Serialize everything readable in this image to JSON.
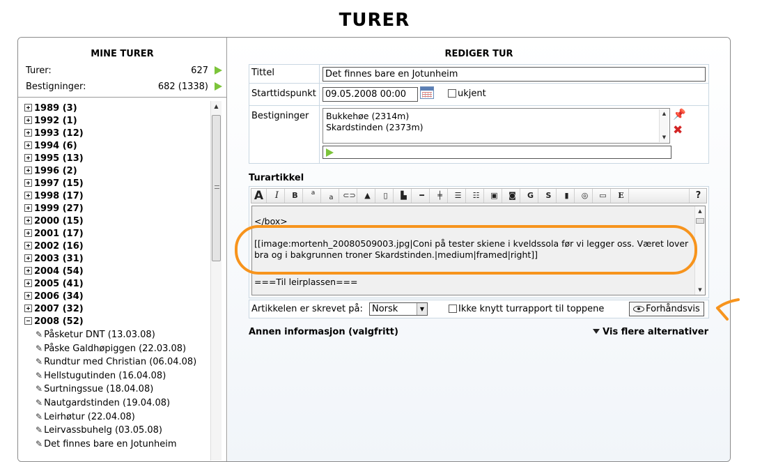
{
  "page": {
    "title": "TURER"
  },
  "left": {
    "title": "MINE TURER",
    "stats": [
      {
        "label": "Turer:",
        "value": "627"
      },
      {
        "label": "Bestigninger:",
        "value": "682 (1338)"
      }
    ],
    "years": [
      {
        "label": "1989 (3)",
        "expanded": false
      },
      {
        "label": "1992 (1)",
        "expanded": false
      },
      {
        "label": "1993 (12)",
        "expanded": false
      },
      {
        "label": "1994 (6)",
        "expanded": false
      },
      {
        "label": "1995 (13)",
        "expanded": false
      },
      {
        "label": "1996 (2)",
        "expanded": false
      },
      {
        "label": "1997 (15)",
        "expanded": false
      },
      {
        "label": "1998 (17)",
        "expanded": false
      },
      {
        "label": "1999 (27)",
        "expanded": false
      },
      {
        "label": "2000 (15)",
        "expanded": false
      },
      {
        "label": "2001 (17)",
        "expanded": false
      },
      {
        "label": "2002 (16)",
        "expanded": false
      },
      {
        "label": "2003 (31)",
        "expanded": false
      },
      {
        "label": "2004 (54)",
        "expanded": false
      },
      {
        "label": "2005 (41)",
        "expanded": false
      },
      {
        "label": "2006 (34)",
        "expanded": false
      },
      {
        "label": "2007 (32)",
        "expanded": false
      },
      {
        "label": "2008 (52)",
        "expanded": true
      }
    ],
    "trips": [
      "Påsketur DNT (13.03.08)",
      "Påske Galdhøpiggen (22.03.08)",
      "Rundtur med Christian (06.04.08)",
      "Hellstugutinden (16.04.08)",
      "Surtningssue (18.04.08)",
      "Nautgardstinden (19.04.08)",
      "Leirhøtur (22.04.08)",
      "Leirvassbuhelg (03.05.08)",
      "Det finnes bare en Jotunheim"
    ]
  },
  "form": {
    "title": "REDIGER TUR",
    "title_label": "Tittel",
    "title_value": "Det finnes bare en Jotunheim",
    "start_label": "Starttidspunkt",
    "start_value": "09.05.2008 00:00",
    "unknown_label": "ukjent",
    "ascents_label": "Bestigninger",
    "ascents": [
      "Bukkehøe (2314m)",
      "Skardstinden (2373m)"
    ],
    "article_label": "Turartikkel",
    "toolbar_buttons": [
      "A",
      "I",
      "B",
      "a",
      "a",
      "link",
      "peak",
      "page",
      "boot",
      "hr",
      "table",
      "ul",
      "ol",
      "img",
      "map",
      "G",
      "S",
      "film",
      "cd",
      "doc",
      "E",
      "?"
    ],
    "editor_lines": [
      "</box>",
      "[[image:mortenh_20080509003.jpg|Coni på tester skiene i kveldssola før vi legger oss. Været lover bra og i bakgrunnen troner Skardstinden.|medium|framed|right]]",
      "===Til leirplassen==="
    ],
    "written_in_label": "Artikkelen er skrevet på:",
    "language": "Norsk",
    "no_link_label": "Ikke knytt turrapport til toppene",
    "preview_label": "Forhåndsvis",
    "more_info_label": "Annen informasjon (valgfritt)",
    "more_options_label": "Vis flere alternativer"
  },
  "colors": {
    "accent_green": "#7cc43a",
    "highlight_orange": "#f7941d",
    "delete_red": "#d32424"
  }
}
